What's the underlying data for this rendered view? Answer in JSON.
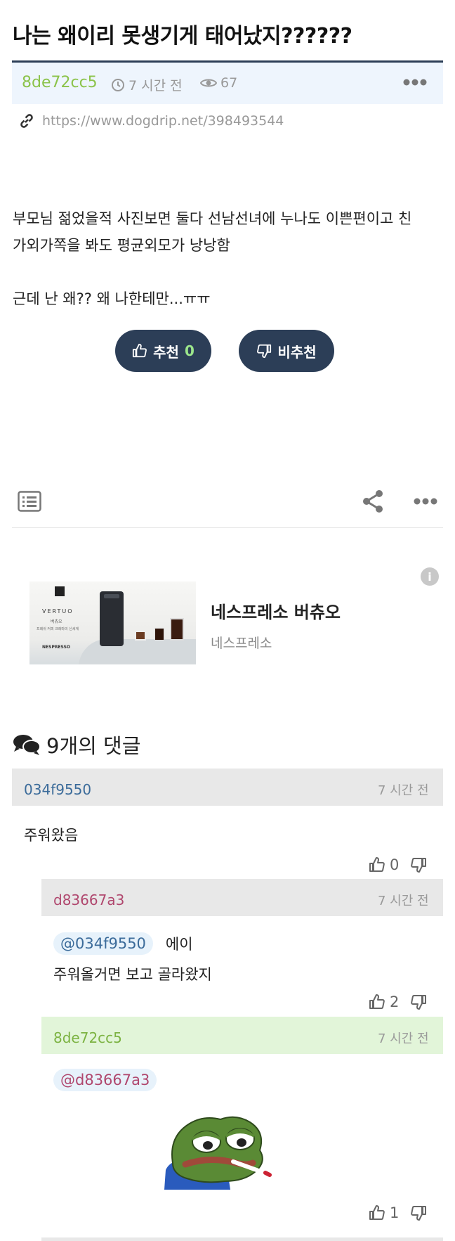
{
  "post": {
    "title": "나는 왜이리 못생기게 태어났지??????",
    "author": "8de72cc5",
    "time": "7 시간 전",
    "views": "67",
    "url": "https://www.dogdrip.net/398493544",
    "body_line1": "부모님 젊었을적 사진보면 둘다 선남선녀에 누나도 이쁜편이고 친",
    "body_line2": "가외가쪽을 봐도 평균외모가 낭낭함",
    "body_line3": "근데 난 왜?? 왜 나한테만...ㅠㅠ",
    "upvote_label": "추천",
    "upvote_count": "0",
    "downvote_label": "비추천"
  },
  "ad": {
    "brand": "네스프레소 버츄오",
    "subtitle": "네스프레소",
    "info_glyph": "i",
    "image_text_vertuo": "VERTUO",
    "image_text_korean": "버츄오",
    "image_text_tagline": "프레쉬 커피 크레마의 신세계",
    "image_logo": "NESPRESSO"
  },
  "comments": {
    "header": "9개의 댓글",
    "items": [
      {
        "author": "034f9550",
        "author_color": "#3b6b9a",
        "time": "7 시간 전",
        "text": "주워왔음",
        "likes": "0"
      },
      {
        "author": "d83667a3",
        "author_color": "#b0476e",
        "time": "7 시간 전",
        "mention": "@034f9550",
        "mention_color": "#3b6b9a",
        "text_inline": "에이",
        "text": "주워올거면 보고 골라왔지",
        "likes": "2"
      },
      {
        "author": "8de72cc5",
        "author_color": "#7cb342",
        "time": "7 시간 전",
        "mention": "@d83667a3",
        "mention_color": "#b0476e",
        "likes": "1"
      }
    ]
  },
  "colors": {
    "accent": "#2c3e57",
    "author_green": "#8bc34a",
    "meta_bg": "#eef5fd"
  },
  "icons": {
    "time": "clock-icon",
    "views": "eye-icon",
    "link": "link-icon",
    "list": "list-icon",
    "share": "share-icon",
    "more": "more-icon",
    "like": "thumbs-up-icon",
    "dislike": "thumbs-down-icon",
    "comments": "comments-icon"
  }
}
